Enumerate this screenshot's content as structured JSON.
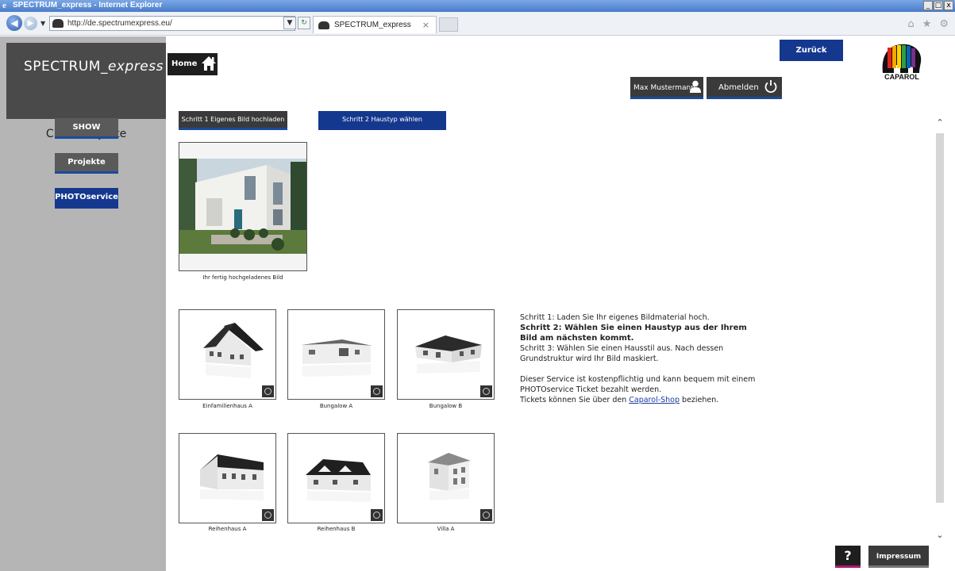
{
  "browser": {
    "window_title": "SPECTRUM_express - Internet Explorer",
    "url": "http://de.spectrumexpress.eu/",
    "tab_title": "SPECTRUM_express",
    "window_buttons": [
      "_",
      "□",
      "x"
    ]
  },
  "sidebar": {
    "brand_prefix": "SPECTRUM_",
    "brand_suffix": "express",
    "section_title": "Cloud Projekte",
    "items": [
      {
        "label": "SHOW"
      },
      {
        "label": "Projekte"
      },
      {
        "label": "PHOTOservice"
      }
    ]
  },
  "header": {
    "home_label": "Home",
    "back_label": "Zurück",
    "user_label": "Max Mustermann",
    "logout_label": "Abmelden",
    "logo_text": "CAPAROL"
  },
  "steps": {
    "step1_label": "Schritt 1 Eigenes Bild hochladen",
    "step2_label": "Schritt 2 Haustyp wählen"
  },
  "upload": {
    "caption": "Ihr fertig hochgeladenes Bild"
  },
  "house_types": [
    {
      "label": "Einfamilienhaus A"
    },
    {
      "label": "Bungalow A"
    },
    {
      "label": "Bungalow B"
    },
    {
      "label": "Reihenhaus A"
    },
    {
      "label": "Reihenhaus B"
    },
    {
      "label": "Villa A"
    }
  ],
  "info": {
    "line1": "Schritt 1: Laden Sie Ihr eigenes Bildmaterial hoch.",
    "line2": "Schritt 2: Wählen Sie einen Haustyp aus der Ihrem Bild am nächsten kommt.",
    "line3": "Schritt 3: Wählen Sie einen Hausstil aus. Nach dessen Grundstruktur wird Ihr Bild maskiert.",
    "line4": "Dieser Service ist kostenpflichtig und kann bequem mit einem PHOTOservice Ticket bezahlt werden.",
    "line5_prefix": "Tickets können Sie über den ",
    "line5_link": "Caparol-Shop",
    "line5_suffix": " beziehen."
  },
  "footer": {
    "help_label": "?",
    "impressum_label": "Impressum"
  },
  "colors": {
    "accent_blue": "#15388f",
    "sidebar_gray": "#b5b5b5",
    "dark_button": "#3a3a3a"
  }
}
